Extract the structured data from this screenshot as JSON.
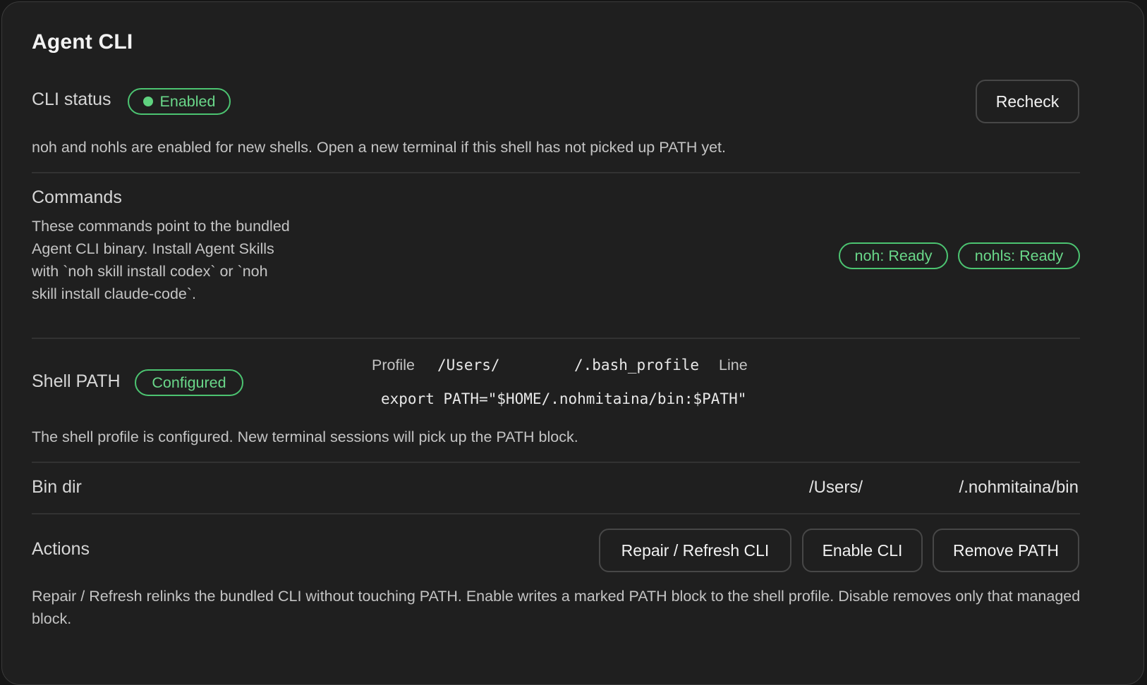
{
  "panel": {
    "title": "Agent CLI"
  },
  "cli_status": {
    "label": "CLI status",
    "badge": "Enabled",
    "recheck_label": "Recheck",
    "description": "noh and nohls are enabled for new shells. Open a new terminal if this shell has not picked up PATH yet."
  },
  "commands": {
    "label": "Commands",
    "description": "These commands point to the bundled Agent CLI binary. Install Agent Skills with `noh skill install codex` or `noh skill install claude-code`.",
    "badges": [
      "noh: Ready",
      "nohls: Ready"
    ]
  },
  "shell_path": {
    "label": "Shell PATH",
    "badge": "Configured",
    "profile_label": "Profile",
    "profile_path_start": "/Users/",
    "profile_path_end": "/.bash_profile",
    "line_label": "Line",
    "export_line": "export PATH=\"$HOME/.nohmitaina/bin:$PATH\"",
    "description": "The shell profile is configured. New terminal sessions will pick up the PATH block."
  },
  "bin_dir": {
    "label": "Bin dir",
    "path_start": "/Users/",
    "path_end": "/.nohmitaina/bin"
  },
  "actions": {
    "label": "Actions",
    "repair_label": "Repair / Refresh CLI",
    "enable_label": "Enable CLI",
    "remove_label": "Remove PATH",
    "description": "Repair / Refresh relinks the bundled CLI without touching PATH. Enable writes a marked PATH block to the shell profile. Disable removes only that managed block."
  },
  "colors": {
    "background": "#1f1f1f",
    "accent_green": "#4cc471",
    "text": "#e8e8e8",
    "muted": "#c4c4c4"
  },
  "icons": {
    "status_dot": "status-dot-icon"
  }
}
